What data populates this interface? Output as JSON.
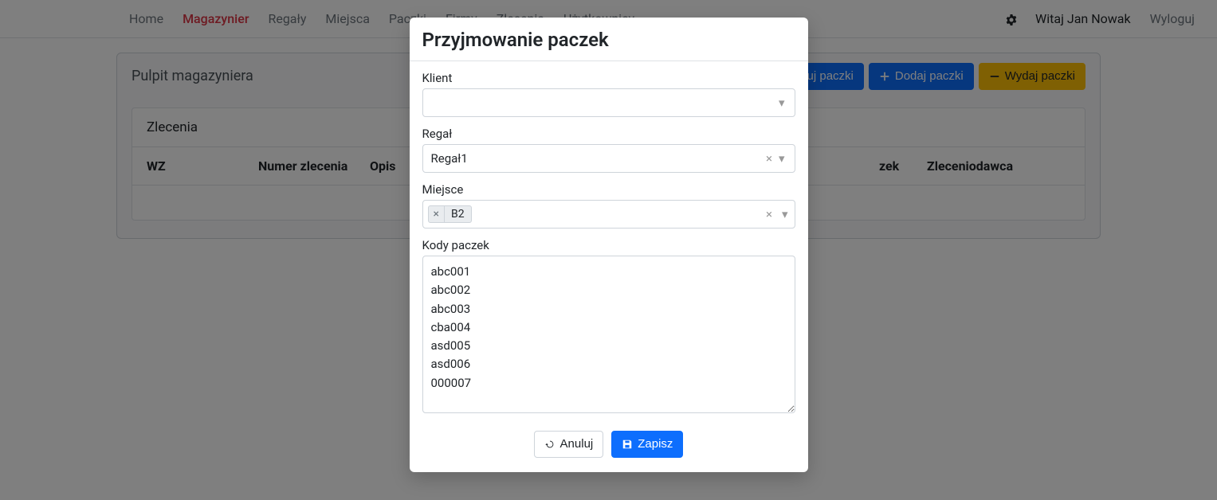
{
  "nav": {
    "items": [
      {
        "label": "Home"
      },
      {
        "label": "Magazynier"
      },
      {
        "label": "Regały"
      },
      {
        "label": "Miejsca"
      },
      {
        "label": "Paczki"
      },
      {
        "label": "Firmy"
      },
      {
        "label": "Zlecenia"
      },
      {
        "label": "Użytkownicy"
      }
    ],
    "greeting": "Witaj Jan Nowak",
    "logout": "Wyloguj"
  },
  "dashboard": {
    "title": "Pulpit magazyniera",
    "buttons": {
      "edit": "Edytuj paczki",
      "add": "Dodaj paczki",
      "issue": "Wydaj paczki"
    },
    "tab": "Zlecenia",
    "columns": {
      "wz": "WZ",
      "numer": "Numer zlecenia",
      "opis": "Opis",
      "zek": "zek",
      "zleceniodawca": "Zleceniodawca"
    }
  },
  "modal": {
    "title": "Przyjmowanie paczek",
    "labels": {
      "klient": "Klient",
      "regal": "Regał",
      "miejsce": "Miejsce",
      "kody": "Kody paczek"
    },
    "values": {
      "klient": "",
      "regal": "Regał1",
      "miejsce_tag": "B2",
      "kody": "abc001\nabc002\nabc003\ncba004\nasd005\nasd006\n000007"
    },
    "buttons": {
      "cancel": "Anuluj",
      "save": "Zapisz"
    }
  }
}
